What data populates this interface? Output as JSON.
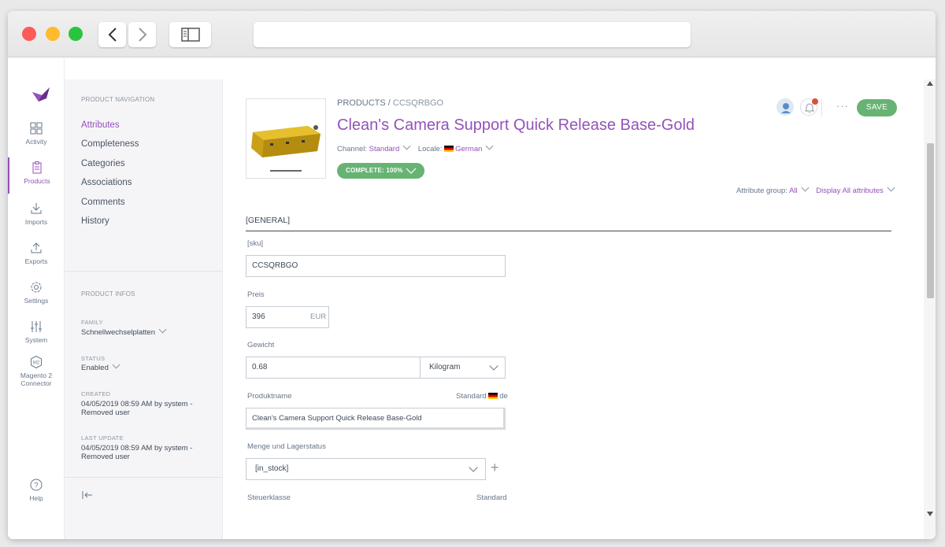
{
  "browser": {
    "url": ""
  },
  "mainnav": {
    "items": [
      {
        "label": "Activity",
        "icon": "dashboard-icon"
      },
      {
        "label": "Products",
        "icon": "clipboard-icon"
      },
      {
        "label": "Imports",
        "icon": "download-icon"
      },
      {
        "label": "Exports",
        "icon": "upload-icon"
      },
      {
        "label": "Settings",
        "icon": "gear-icon"
      },
      {
        "label": "System",
        "icon": "sliders-icon"
      },
      {
        "label": "Magento 2",
        "icon": "magento-icon"
      },
      {
        "label": "Connector"
      },
      {
        "label": "Help",
        "icon": "help-icon"
      }
    ]
  },
  "subnav": {
    "nav_title": "PRODUCT NAVIGATION",
    "links": [
      "Attributes",
      "Completeness",
      "Categories",
      "Associations",
      "Comments",
      "History"
    ],
    "infos_title": "PRODUCT INFOS",
    "family_label": "FAMILY",
    "family_value": "Schnellwechselplatten",
    "status_label": "STATUS",
    "status_value": "Enabled",
    "created_label": "CREATED",
    "created_value": "04/05/2019 08:59 AM by system - Removed user",
    "updated_label": "LAST UPDATE",
    "updated_value": "04/05/2019 08:59 AM by system - Removed user"
  },
  "header": {
    "crumb_root": "PRODUCTS",
    "crumb_sep": "/",
    "crumb_code": "CCSQRBGO",
    "title": "Clean's Camera Support Quick Release Base-Gold",
    "channel_label": "Channel:",
    "channel_value": "Standard",
    "locale_label": "Locale:",
    "locale_value": "German",
    "complete": "COMPLETE: 100%",
    "save": "SAVE",
    "more": "···",
    "attr_group_label": "Attribute group:",
    "attr_group_value": "All",
    "display_value": "Display All attributes"
  },
  "form": {
    "group": "[GENERAL]",
    "sku_label": "[sku]",
    "sku_value": "CCSQRBGO",
    "preis_label": "Preis",
    "preis_value": "396",
    "preis_unit": "EUR",
    "gewicht_label": "Gewicht",
    "gewicht_value": "0.68",
    "gewicht_unit": "Kilogram",
    "produktname_label": "Produktname",
    "produktname_scope": "Standard",
    "produktname_locale": "de",
    "produktname_value": "Clean's Camera Support Quick Release Base-Gold",
    "menge_label": "Menge und Lagerstatus",
    "menge_value": "[in_stock]",
    "steuer_label": "Steuerklasse",
    "steuer_scope": "Standard"
  },
  "colors": {
    "accent": "#9452ba",
    "success": "#67b373",
    "text": "#3f4a5a"
  }
}
